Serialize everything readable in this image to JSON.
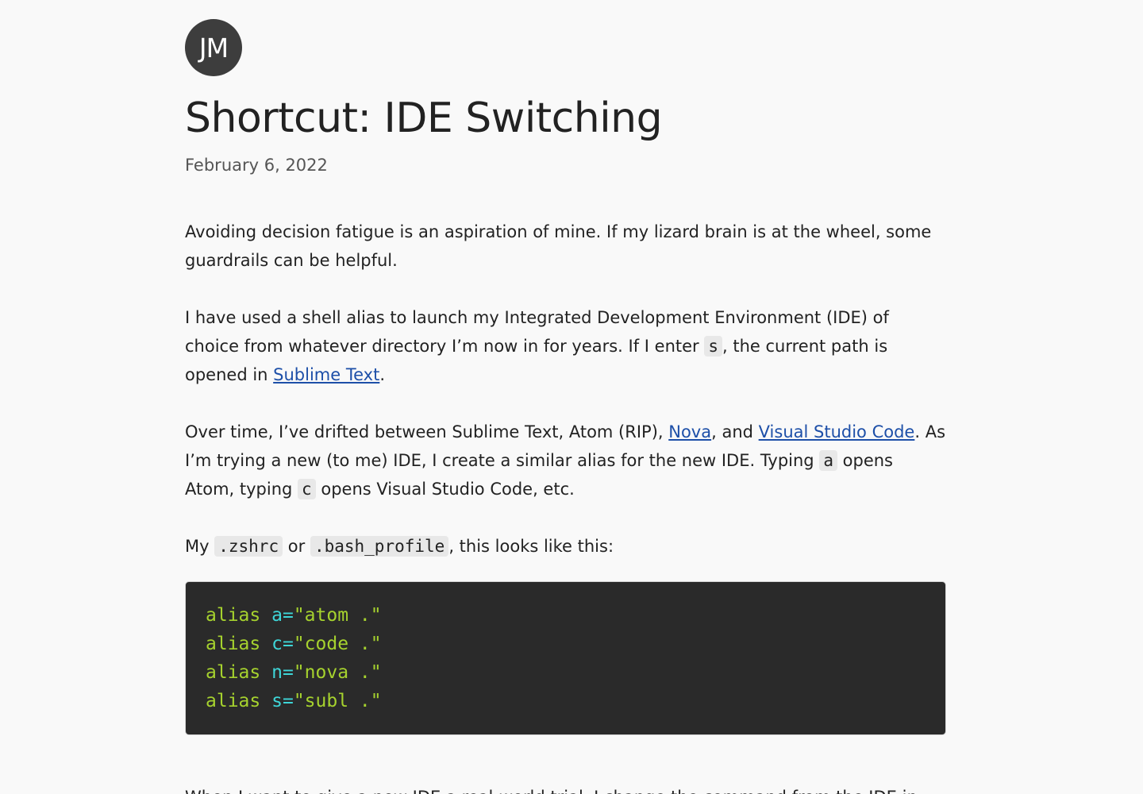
{
  "author": {
    "initials": "JM"
  },
  "post": {
    "title": "Shortcut: IDE Switching",
    "date": "February 6, 2022"
  },
  "paragraphs": {
    "p1": "Avoiding decision fatigue is an aspiration of mine. If my lizard brain is at the wheel, some guardrails can be helpful.",
    "p2": {
      "a": "I have used a shell alias to launch my Integrated Development Environment (IDE) of choice from whatever directory I’m now in for years. If I enter ",
      "code_s": "s",
      "b": ", the current path is opened in ",
      "link_sublime": "Sublime Text",
      "c": "."
    },
    "p3": {
      "a": "Over time, I’ve drifted between Sublime Text, Atom (RIP), ",
      "link_nova": "Nova",
      "b": ", and ",
      "link_vscode": "Visual Studio Code",
      "c": ". As I’m trying a new (to me) IDE, I create a similar alias for the new IDE. Typing ",
      "code_a": "a",
      "d": " opens Atom, typing ",
      "code_c": "c",
      "e": " opens Visual Studio Code, etc."
    },
    "p4": {
      "a": "My ",
      "code_zshrc": ".zshrc",
      "b": " or ",
      "code_bash": ".bash_profile",
      "c": ", this looks like this:"
    },
    "p5": "When I want to give a new IDE a real-world trial, I change the command from the IDE in"
  },
  "code_block": {
    "lines": [
      {
        "kw": "alias",
        "var": "a=",
        "str": "\"atom .\""
      },
      {
        "kw": "alias",
        "var": "c=",
        "str": "\"code .\""
      },
      {
        "kw": "alias",
        "var": "n=",
        "str": "\"nova .\""
      },
      {
        "kw": "alias",
        "var": "s=",
        "str": "\"subl .\""
      }
    ]
  },
  "colors": {
    "background": "#f9f9f9",
    "text": "#222222",
    "link": "#1d4fa8",
    "code_bg": "#2a2a2a",
    "code_keyword": "#a6d22e",
    "code_variable": "#3ed6d8"
  }
}
